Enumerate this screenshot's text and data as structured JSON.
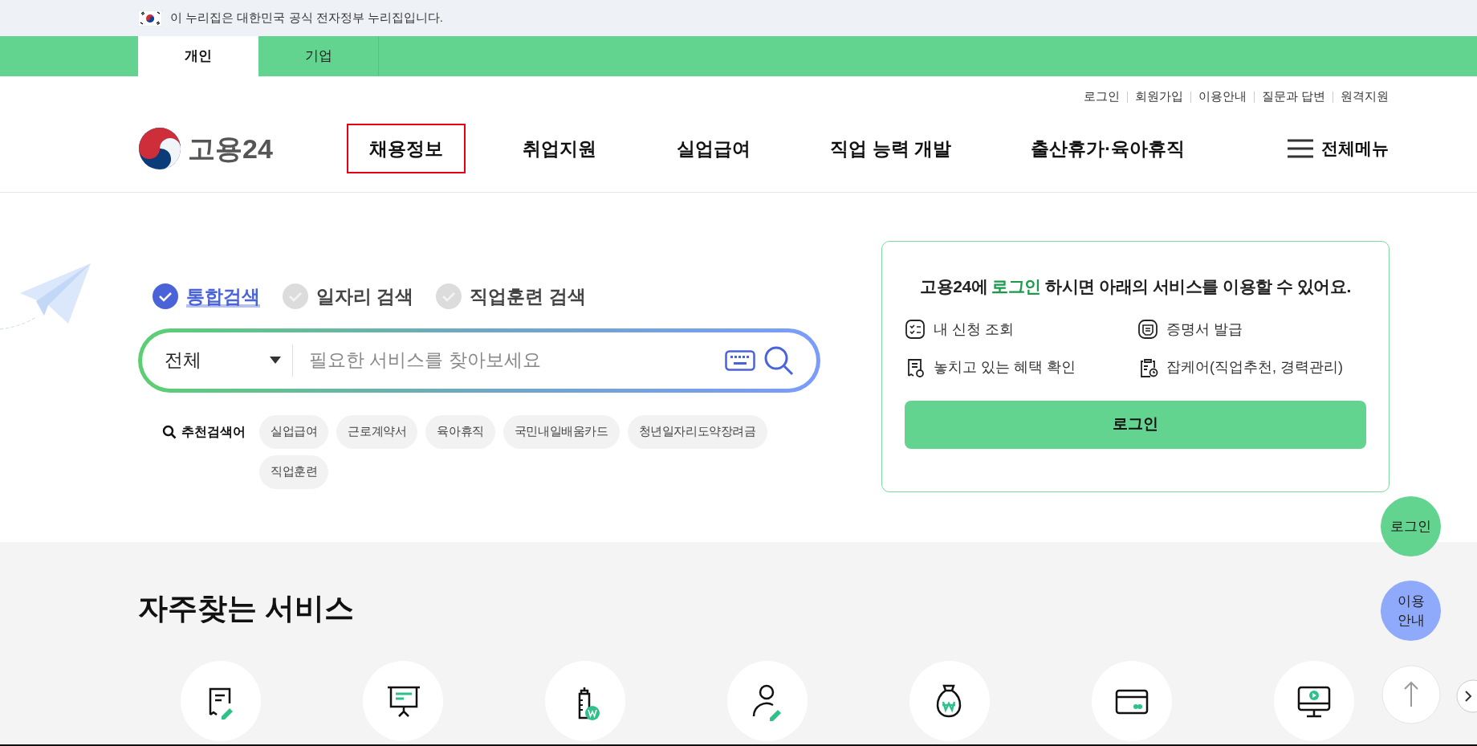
{
  "gov_banner": {
    "text": "이 누리집은 대한민국 공식 전자정부 누리집입니다."
  },
  "audience_tabs": [
    {
      "label": "개인",
      "selected": true
    },
    {
      "label": "기업",
      "selected": false
    }
  ],
  "util_links": [
    "로그인",
    "회원가입",
    "이용안내",
    "질문과 답변",
    "원격지원"
  ],
  "logo": {
    "text": "고용24"
  },
  "nav": [
    {
      "label": "채용정보",
      "highlighted": true
    },
    {
      "label": "취업지원",
      "highlighted": false
    },
    {
      "label": "실업급여",
      "highlighted": false
    },
    {
      "label": "직업 능력 개발",
      "highlighted": false
    },
    {
      "label": "출산휴가·육아휴직",
      "highlighted": false
    }
  ],
  "all_menu": "전체메뉴",
  "search_types": [
    {
      "label": "통합검색",
      "selected": true
    },
    {
      "label": "일자리 검색",
      "selected": false
    },
    {
      "label": "직업훈련 검색",
      "selected": false
    }
  ],
  "search": {
    "category": "전체",
    "placeholder": "필요한 서비스를 찾아보세요"
  },
  "recommended": {
    "label": "추천검색어",
    "keywords": [
      "실업급여",
      "근로계약서",
      "육아휴직",
      "국민내일배움카드",
      "청년일자리도약장려금",
      "직업훈련"
    ]
  },
  "login_card": {
    "message_before": "고용24에 ",
    "message_link": "로그인",
    "message_after": " 하시면 아래의 서비스를 이용할 수 있어요.",
    "services": [
      {
        "kind": "checklist",
        "label": "내 신청 조회"
      },
      {
        "kind": "certificate",
        "label": "증명서 발급"
      },
      {
        "kind": "benefit",
        "label": "놓치고 있는 혜택 확인"
      },
      {
        "kind": "clipboard",
        "label": "잡케어(직업추천, 경력관리)"
      }
    ],
    "button": "로그인"
  },
  "frequent": {
    "title": "자주찾는 서비스",
    "icons": [
      {
        "kind": "document-pen"
      },
      {
        "kind": "presentation"
      },
      {
        "kind": "bottle"
      },
      {
        "kind": "person-pen"
      },
      {
        "kind": "money-bag"
      },
      {
        "kind": "card"
      },
      {
        "kind": "monitor-play"
      }
    ]
  },
  "floating": [
    {
      "kind": "login",
      "label": "로그인"
    },
    {
      "kind": "guide",
      "label": "이용\n안내"
    }
  ]
}
